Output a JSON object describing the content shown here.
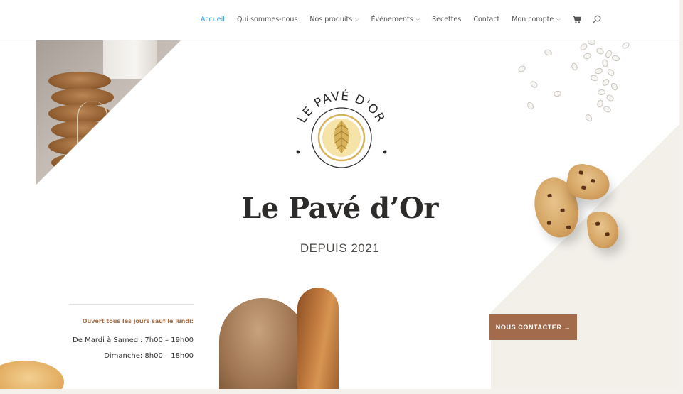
{
  "nav": {
    "items": [
      {
        "label": "Accueil",
        "active": true,
        "dropdown": false
      },
      {
        "label": "Qui sommes-nous",
        "active": false,
        "dropdown": false
      },
      {
        "label": "Nos produits",
        "active": false,
        "dropdown": true
      },
      {
        "label": "Évènements",
        "active": false,
        "dropdown": true
      },
      {
        "label": "Recettes",
        "active": false,
        "dropdown": false
      },
      {
        "label": "Contact",
        "active": false,
        "dropdown": false
      },
      {
        "label": "Mon compte",
        "active": false,
        "dropdown": true
      }
    ],
    "active_color": "#2ea3f2",
    "icons": [
      "cart-icon",
      "search-icon"
    ]
  },
  "logo": {
    "arc_text": "LE PAVÉ D'OR",
    "emblem": "golden-hop-emblem"
  },
  "hero": {
    "title": "Le Pavé d’Or",
    "subtitle": "DEPUIS 2021"
  },
  "hours": {
    "note": "Ouvert tous les jours sauf le lundi:",
    "weekdays": "De Mardi à Samedi: 7h00 – 19h00",
    "sunday": "Dimanche: 8h00 – 18h00"
  },
  "cta": {
    "label": "NOUS CONTACTER →",
    "color": "#a26c4c"
  },
  "colors": {
    "accent_brown": "#a26c4c",
    "gold": "#d8b25a",
    "dark_text": "#2c2b29"
  }
}
